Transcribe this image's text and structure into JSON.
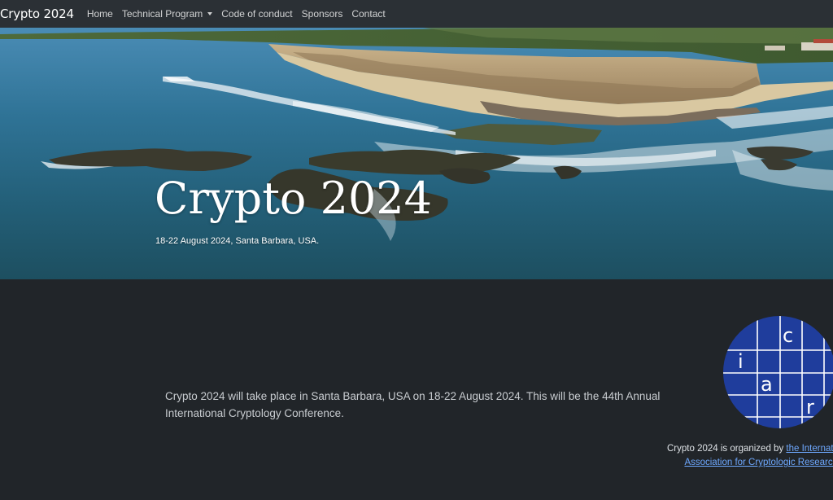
{
  "navbar": {
    "brand": "Crypto 2024",
    "items": [
      {
        "label": "Home"
      },
      {
        "label": "Technical Program",
        "dropdown": true
      },
      {
        "label": "Code of conduct"
      },
      {
        "label": "Sponsors"
      },
      {
        "label": "Contact"
      }
    ]
  },
  "hero": {
    "title": "Crypto 2024",
    "subtitle": "18-22 August 2024, Santa Barbara, USA."
  },
  "main": {
    "intro": "Crypto 2024 will take place in Santa Barbara, USA on 18-22 August 2024. This will be the 44th Annual International Cryptology Conference."
  },
  "logo": {
    "letters": {
      "c": "c",
      "i": "i",
      "a": "a",
      "r": "r"
    },
    "color": "#1f3d9c"
  },
  "organizer": {
    "prefix": "Crypto 2024 is organized by",
    "link_line1": "the International",
    "link_line2": "Association for Cryptologic Research"
  },
  "colors": {
    "navbar_bg": "#2b3035",
    "page_bg": "#212529",
    "link": "#6ea8fe"
  }
}
